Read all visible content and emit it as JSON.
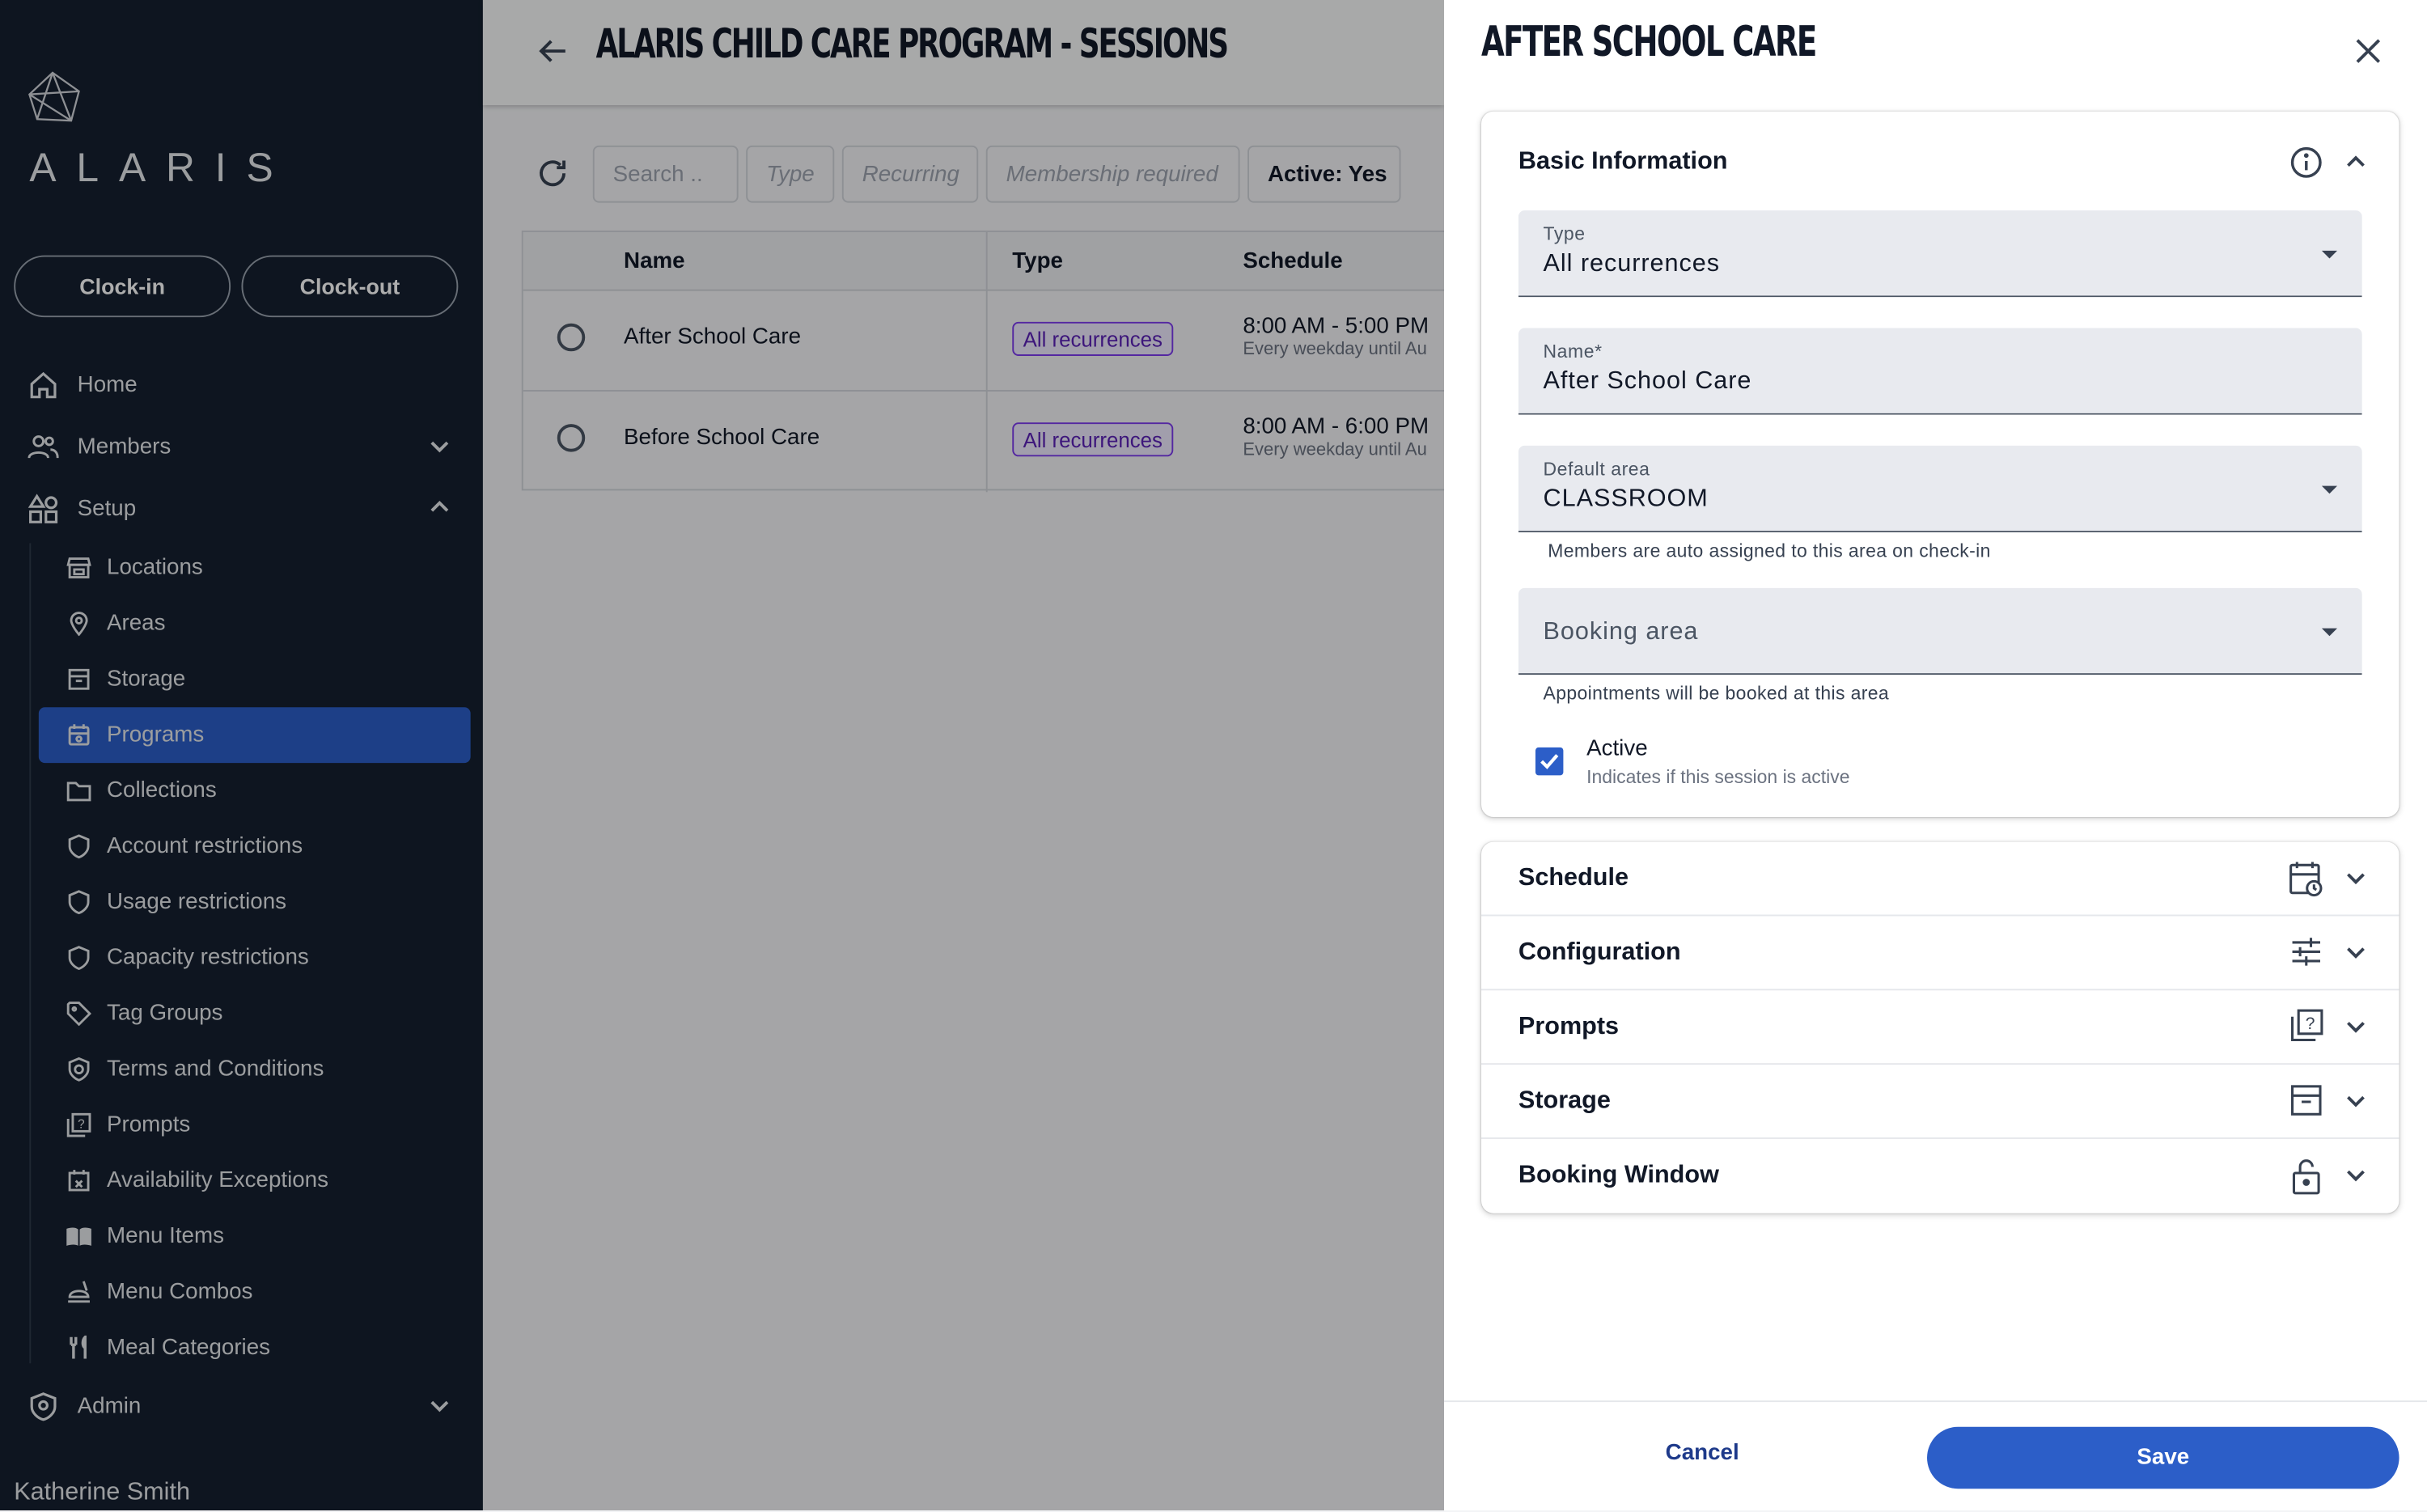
{
  "brand": {
    "logo_text": "ALARIS"
  },
  "sidebar": {
    "clock_in": "Clock-in",
    "clock_out": "Clock-out",
    "home": "Home",
    "members": "Members",
    "setup": "Setup",
    "sub_items": [
      {
        "label": "Locations",
        "icon": "storefront-icon"
      },
      {
        "label": "Areas",
        "icon": "map-pin-icon"
      },
      {
        "label": "Storage",
        "icon": "archive-icon"
      },
      {
        "label": "Programs",
        "icon": "calendar-program-icon",
        "active": true
      },
      {
        "label": "Collections",
        "icon": "folder-icon"
      },
      {
        "label": "Account restrictions",
        "icon": "shield-icon"
      },
      {
        "label": "Usage restrictions",
        "icon": "shield-icon"
      },
      {
        "label": "Capacity restrictions",
        "icon": "shield-icon"
      },
      {
        "label": "Tag Groups",
        "icon": "tag-icon"
      },
      {
        "label": "Terms and Conditions",
        "icon": "shield-check-icon"
      },
      {
        "label": "Prompts",
        "icon": "prompt-icon"
      },
      {
        "label": "Availability Exceptions",
        "icon": "calendar-x-icon"
      },
      {
        "label": "Menu Items",
        "icon": "menu-book-icon"
      },
      {
        "label": "Menu Combos",
        "icon": "combo-icon"
      },
      {
        "label": "Meal Categories",
        "icon": "utensils-icon"
      }
    ],
    "admin": "Admin",
    "user_name": "Katherine Smith",
    "active_color": "#2c5ec8"
  },
  "main": {
    "title": "ALARIS CHILD CARE PROGRAM  -  SESSIONS",
    "filters": {
      "search_placeholder": "Search ..",
      "type": "Type",
      "recurring": "Recurring",
      "membership": "Membership required",
      "active": "Active: Yes"
    },
    "table": {
      "headers": {
        "name": "Name",
        "type": "Type",
        "schedule": "Schedule"
      },
      "rows": [
        {
          "name": "After School Care",
          "type": "All recurrences",
          "time": "8:00 AM - 5:00 PM",
          "recurrence": "Every weekday until Au"
        },
        {
          "name": "Before School Care",
          "type": "All recurrences",
          "time": "8:00 AM - 6:00 PM",
          "recurrence": "Every weekday until Au"
        }
      ]
    }
  },
  "drawer": {
    "title": "AFTER SCHOOL CARE",
    "basic": {
      "heading": "Basic Information",
      "type_label": "Type",
      "type_value": "All recurrences",
      "name_label": "Name*",
      "name_value": "After School Care",
      "area_label": "Default area",
      "area_value": "CLASSROOM",
      "area_helper": "Members are auto assigned to this area on check-in",
      "booking_placeholder": "Booking area",
      "booking_helper": "Appointments will be booked at this area",
      "active_label": "Active",
      "active_helper": "Indicates if this session is active",
      "active_checked": true
    },
    "sections": [
      {
        "label": "Schedule",
        "icon": "calendar-clock-icon"
      },
      {
        "label": "Configuration",
        "icon": "sliders-icon"
      },
      {
        "label": "Prompts",
        "icon": "prompt-icon"
      },
      {
        "label": "Storage",
        "icon": "archive-icon"
      },
      {
        "label": "Booking Window",
        "icon": "lock-open-icon"
      }
    ],
    "cancel": "Cancel",
    "save": "Save"
  }
}
